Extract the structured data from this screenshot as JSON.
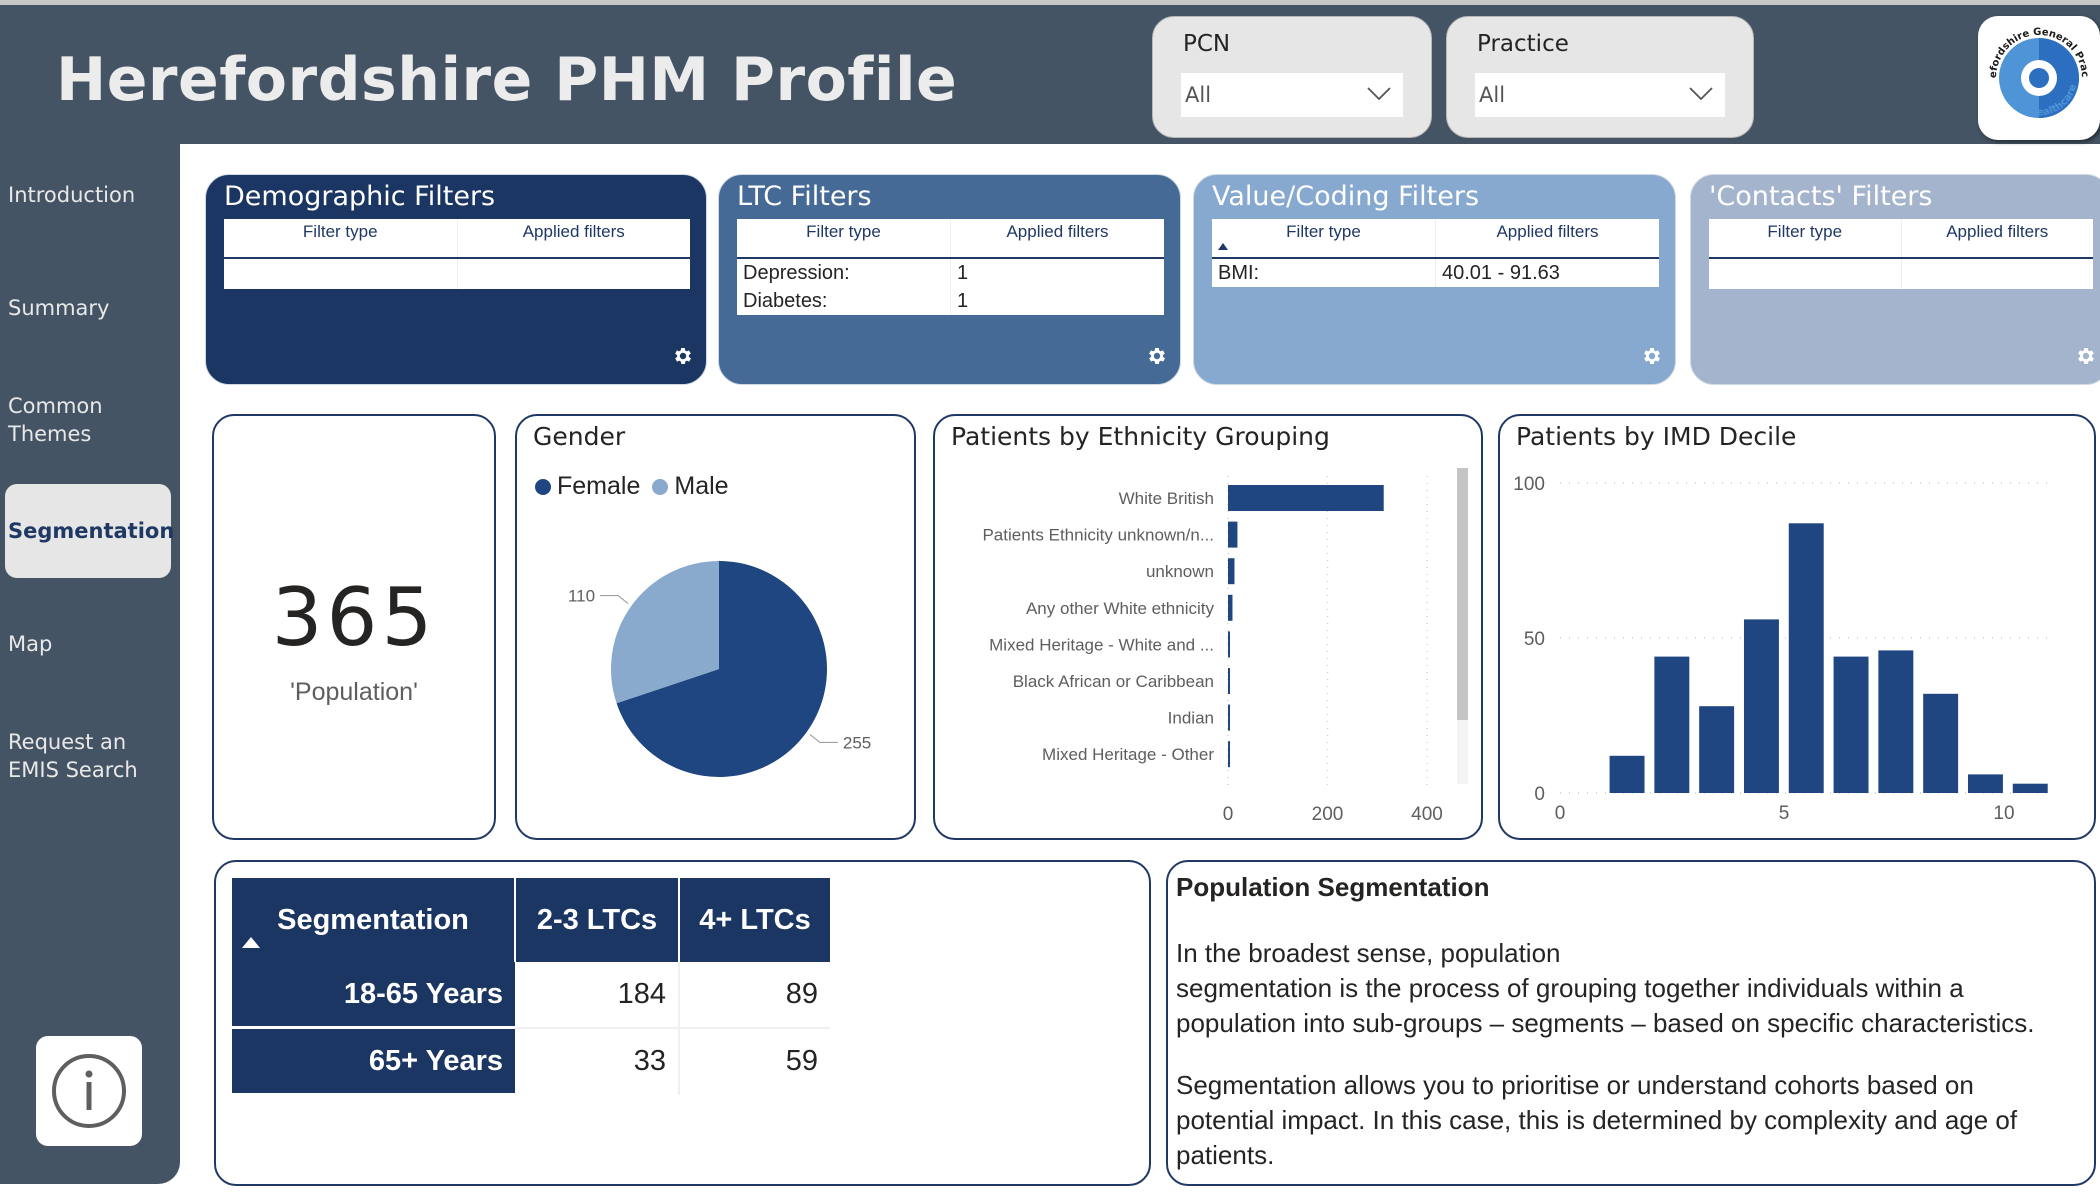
{
  "header": {
    "title": "Herefordshire PHM Profile",
    "slicers": [
      {
        "label": "PCN",
        "value": "All"
      },
      {
        "label": "Practice",
        "value": "All"
      }
    ],
    "logo": {
      "top_text": "Herefordshire General Practice",
      "bottom_text": "Taurus Healthcare"
    }
  },
  "sidebar": {
    "items": [
      {
        "label": "Introduction",
        "active": false
      },
      {
        "label": "Summary",
        "active": false
      },
      {
        "label": "Common Themes",
        "active": false
      },
      {
        "label": "Segmentation",
        "active": true
      },
      {
        "label": "Map",
        "active": false
      },
      {
        "label": "Request an EMIS Search",
        "active": false
      }
    ],
    "info_button": "info"
  },
  "filter_panels": [
    {
      "title": "Demographic Filters",
      "col1": "Filter type",
      "col2": "Applied filters",
      "rows": [],
      "color": "#1b3663"
    },
    {
      "title": "LTC Filters",
      "col1": "Filter type",
      "col2": "Applied filters",
      "rows": [
        [
          "Depression:",
          "1"
        ],
        [
          "Diabetes:",
          "1"
        ]
      ],
      "color": "#466a96"
    },
    {
      "title": "Value/Coding Filters",
      "col1": "Filter type",
      "col2": "Applied filters",
      "rows": [
        [
          "BMI:",
          "40.01 - 91.63"
        ]
      ],
      "color": "#88a9cf"
    },
    {
      "title": "'Contacts' Filters",
      "col1": "Filter type",
      "col2": "Applied filters",
      "rows": [],
      "color": "#a4b4cc"
    }
  ],
  "kpi": {
    "value": "365",
    "label": "'Population'"
  },
  "colors": {
    "primary": "#1f4680",
    "secondary": "#89a9cd",
    "dark_header": "#455465",
    "navy": "#1b3663"
  },
  "chart_data": [
    {
      "type": "pie",
      "title": "Gender",
      "legend": [
        "Female",
        "Male"
      ],
      "legend_position": "top-left",
      "slices": [
        {
          "name": "Female",
          "value": 255,
          "color": "#1f4680"
        },
        {
          "name": "Male",
          "value": 110,
          "color": "#89a9cd"
        }
      ]
    },
    {
      "type": "bar",
      "orientation": "horizontal",
      "title": "Patients by Ethnicity Grouping",
      "categories": [
        "White British",
        "Patients Ethnicity unknown/n...",
        "unknown",
        "Any other White ethnicity",
        "Mixed Heritage - White and ...",
        "Black African or Caribbean",
        "Indian",
        "Mixed Heritage - Other"
      ],
      "values": [
        313,
        19,
        13,
        9,
        2,
        1,
        1,
        1
      ],
      "xlim": [
        0,
        400
      ],
      "xticks": [
        "0",
        "200",
        "400"
      ],
      "grid": true
    },
    {
      "type": "bar",
      "title": "Patients by IMD Decile",
      "categories": [
        1,
        2,
        3,
        4,
        5,
        6,
        7,
        8,
        9,
        10
      ],
      "values": [
        12,
        44,
        28,
        56,
        87,
        44,
        46,
        32,
        6,
        3
      ],
      "xlim": [
        0,
        10
      ],
      "ylim": [
        0,
        100
      ],
      "xticks": [
        "0",
        "5",
        "10"
      ],
      "yticks": [
        "0",
        "50",
        "100"
      ],
      "grid": true
    }
  ],
  "segmentation_table": {
    "headers": [
      "Segmentation",
      "2-3 LTCs",
      "4+ LTCs"
    ],
    "rows": [
      {
        "label": "18-65 Years",
        "values": [
          "184",
          "89"
        ]
      },
      {
        "label": "65+ Years",
        "values": [
          "33",
          "59"
        ]
      }
    ]
  },
  "text_card": {
    "heading": "Population Segmentation",
    "para1_line1": "In the broadest sense, population",
    "para1_rest": "segmentation is the process of grouping together individuals within a population into sub-groups – segments – based on specific characteristics.",
    "para2": "Segmentation allows you to prioritise or understand cohorts based on potential impact. In this case, this is determined by complexity and age of patients."
  }
}
